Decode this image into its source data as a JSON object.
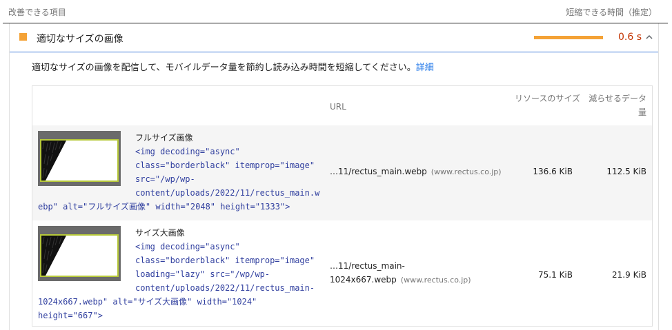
{
  "header": {
    "left_label": "改善できる項目",
    "right_label": "短縮できる時間（推定）"
  },
  "audit": {
    "title": "適切なサイズの画像",
    "saving": "0.6 s",
    "status_color": "#f4a236",
    "description": "適切なサイズの画像を配信して、モバイルデータ量を節約し読み込み時間を短縮してください。",
    "learn_more": "詳細"
  },
  "table": {
    "headers": {
      "url": "URL",
      "resource_size": "リソースのサイズ",
      "savings": "減らせるデータ量"
    },
    "rows": [
      {
        "label": "フルサイズ画像",
        "code_lines": [
          "<img decoding=\"async\"",
          "class=\"borderblack\" itemprop=\"image\"",
          "src=\"/wp/wp-",
          "content/uploads/2022/11/rectus_main.w",
          "ebp\" alt=\"フルサイズ画像\" width=\"2048\" height=\"1333\">"
        ],
        "url": "…11/rectus_main.webp",
        "url_line2": "",
        "domain": "(www.rectus.co.jp)",
        "resource_size": "136.6 KiB",
        "savings": "112.5 KiB"
      },
      {
        "label": "サイズ大画像",
        "code_lines": [
          "<img decoding=\"async\"",
          "class=\"borderblack\" itemprop=\"image\"",
          "loading=\"lazy\" src=\"/wp/wp-",
          "content/uploads/2022/11/rectus_main-",
          "1024x667.webp\" alt=\"サイズ大画像\" width=\"1024\"",
          "height=\"667\">"
        ],
        "url": "…11/rectus_main-",
        "url_line2": "1024x667.webp",
        "domain": "(www.rectus.co.jp)",
        "resource_size": "75.1 KiB",
        "savings": "21.9 KiB"
      }
    ]
  }
}
